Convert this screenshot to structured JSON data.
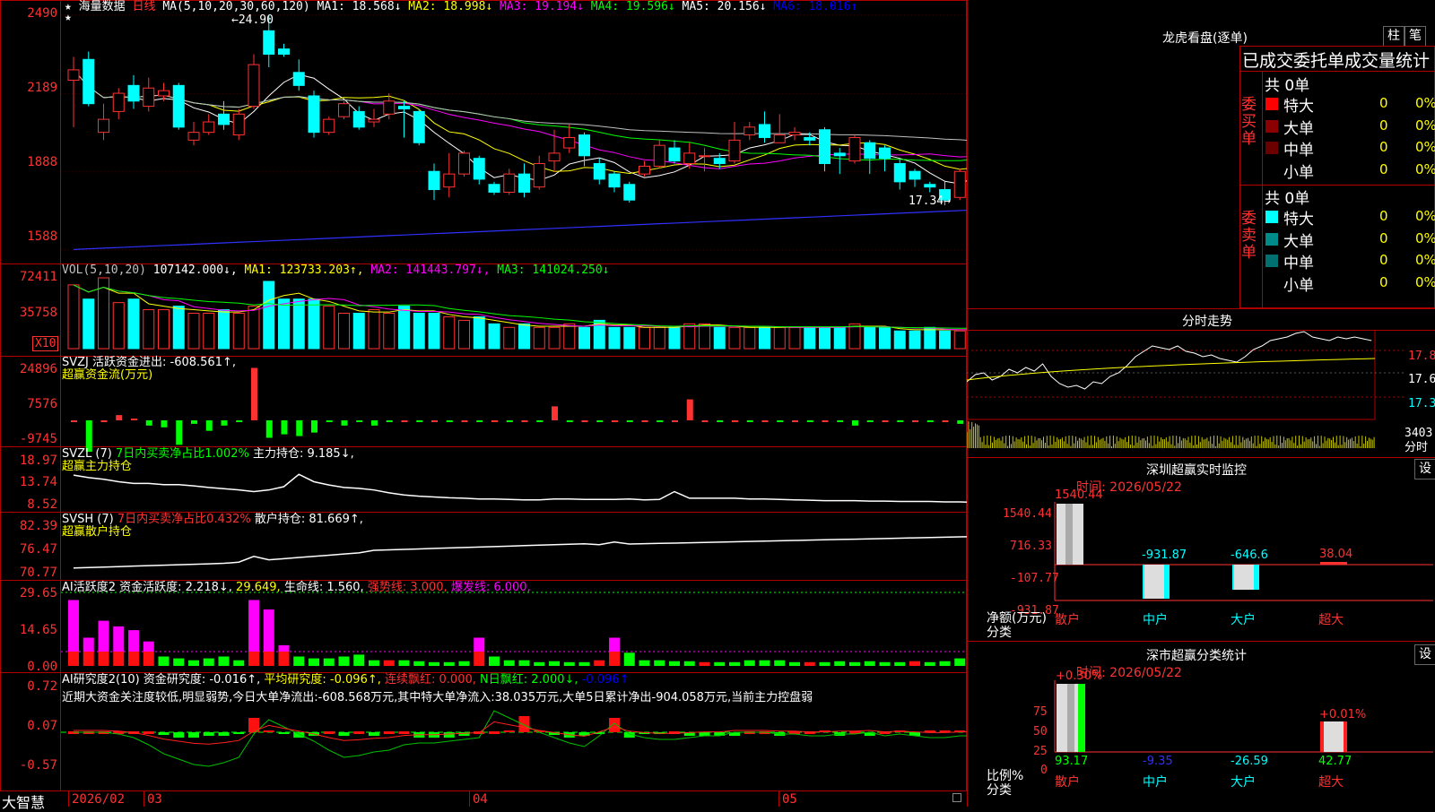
{
  "main": {
    "title": "海量数据",
    "period": "日线",
    "ma_params": "MA(5,10,20,30,60,120)",
    "ma1": "MA1: 18.568↓",
    "ma2": "MA2: 18.998↓",
    "ma3": "MA3: 19.194↓",
    "ma4": "MA4: 19.596↓",
    "ma5": "MA5: 20.156↓",
    "ma6": "MA6: 18.016↑",
    "high_label": "24.90",
    "low_label": "17.34",
    "yticks": [
      "2490",
      "2189",
      "1888",
      "1588"
    ]
  },
  "vol": {
    "header": "VOL(5,10,20)",
    "v": "107142.000↓,",
    "ma1": "MA1: 123733.203↑,",
    "ma2": "MA2: 141443.797↓,",
    "ma3": "MA3: 141024.250↓",
    "yticks": [
      "72411",
      "35758"
    ],
    "unit": "X10"
  },
  "svzj": {
    "line1": "SVZJ  活跃资金进出: -608.561↑,",
    "line2": "超赢资金流(万元)",
    "yticks": [
      "24896",
      "7576",
      "-9745"
    ]
  },
  "svzl": {
    "h1": "SVZL (7)",
    "h2": "7日内买卖净占比1.002%",
    "h3": "主力持仓: 9.185↓,",
    "line2": "超赢主力持仓",
    "yticks": [
      "18.97",
      "13.74",
      "8.52"
    ]
  },
  "svsh": {
    "h1": "SVSH (7)",
    "h2": "7日内买卖净占比0.432%",
    "h3": "散户持仓: 81.669↑,",
    "line2": "超赢散户持仓",
    "yticks": [
      "82.39",
      "76.47",
      "70.77"
    ]
  },
  "ai1": {
    "h1": "AI活跃度2",
    "h2": "资金活跃度: 2.218↓,",
    "h3": "29.649,",
    "h4": "生命线: 1.560,",
    "h5": "强势线: 3.000,",
    "h6": "爆发线: 6.000,",
    "yticks": [
      "29.65",
      "14.65",
      "0.00"
    ]
  },
  "ai2": {
    "h1": "AI研究度2(10)",
    "h2": "资金研究度: -0.016↑,",
    "h3": "平均研究度: -0.096↑,",
    "h4": "连续飘红: 0.000,",
    "h5": "N日飘红: 2.000↓,",
    "h6": "-0.096↑",
    "desc": "近期大资金关注度较低,明显弱势,今日大单净流出:-608.568万元,其中特大单净流入:38.035万元,大单5日累计净出-904.058万元,当前主力控盘弱",
    "yticks": [
      "0.72",
      "0.07",
      "-0.57"
    ]
  },
  "xaxis": {
    "brand": "大智慧",
    "labels": [
      "2026/02",
      "03",
      "04",
      "05"
    ]
  },
  "right": {
    "lhb_title": "龙虎看盘(逐单)",
    "btn_zhu": "柱",
    "btn_bi": "笔",
    "stat_title": "已成交委托单成交量统计",
    "buy_side": "委买单",
    "sell_side": "委卖单",
    "buy_total": "共 0单",
    "sell_total": "共 0单",
    "rows": [
      {
        "label": "特大",
        "v": "0",
        "p": "0%"
      },
      {
        "label": "大单",
        "v": "0",
        "p": "0%"
      },
      {
        "label": "中单",
        "v": "0",
        "p": "0%"
      },
      {
        "label": "小单",
        "v": "0",
        "p": "0%"
      }
    ],
    "fenshi_title": "分时走势",
    "fs_y": [
      "17.85",
      "17.60",
      "17.35"
    ],
    "fs_vol": "3403",
    "fs_vol_unit": "分时",
    "sz_title": "深圳超赢实时监控",
    "sz_btn": "设",
    "sz_time": "时间: 2026/05/22",
    "sz_y": [
      "1540.44",
      "716.33",
      "-107.77",
      "-931.87"
    ],
    "sz_ylabel1": "净额(万元)",
    "sz_ylabel2": "分类",
    "sz_vals": [
      "1540.44",
      "-931.87",
      "-646.6",
      "38.04"
    ],
    "sz_cats": [
      "散户",
      "中户",
      "大户",
      "超大"
    ],
    "ss_title": "深市超赢分类统计",
    "ss_btn": "设",
    "ss_time": "时间: 2026/05/22",
    "ss_y": [
      "75",
      "50",
      "25",
      "0"
    ],
    "ss_ylabel1": "比例%",
    "ss_ylabel2": "分类",
    "ss_tops": [
      "+0.30%",
      "+0.01%"
    ],
    "ss_vals": [
      "93.17",
      "-9.35",
      "-26.59",
      "42.77"
    ],
    "ss_cats": [
      "散户",
      "中户",
      "大户",
      "超大"
    ]
  },
  "chart_data": {
    "type": "candlestick",
    "candles": [
      [
        22.4,
        22.8,
        23.3,
        20.6
      ],
      [
        23.2,
        21.5,
        23.5,
        21.4
      ],
      [
        20.4,
        20.9,
        21.5,
        20.1
      ],
      [
        21.2,
        21.9,
        22.1,
        20.9
      ],
      [
        22.2,
        21.6,
        22.6,
        21.3
      ],
      [
        21.4,
        22.1,
        22.5,
        21.2
      ],
      [
        21.8,
        22.0,
        22.3,
        21.6
      ],
      [
        22.2,
        20.6,
        22.3,
        20.5
      ],
      [
        20.1,
        20.4,
        20.8,
        19.9
      ],
      [
        20.4,
        20.8,
        21.1,
        20.3
      ],
      [
        21.1,
        20.7,
        21.6,
        20.5
      ],
      [
        20.3,
        21.1,
        21.3,
        20.1
      ],
      [
        21.4,
        23.0,
        23.4,
        21.3
      ],
      [
        24.3,
        23.4,
        24.9,
        22.9
      ],
      [
        23.6,
        23.4,
        23.8,
        23.3
      ],
      [
        22.7,
        22.2,
        23.2,
        22.0
      ],
      [
        21.8,
        20.4,
        22.0,
        20.2
      ],
      [
        20.4,
        20.9,
        21.0,
        20.3
      ],
      [
        21.0,
        21.5,
        21.6,
        20.9
      ],
      [
        21.2,
        20.6,
        21.4,
        20.5
      ],
      [
        20.8,
        20.9,
        21.3,
        20.6
      ],
      [
        21.1,
        21.6,
        21.9,
        20.9
      ],
      [
        21.4,
        21.3,
        21.6,
        20.2
      ],
      [
        21.2,
        20.0,
        21.3,
        19.9
      ],
      [
        18.9,
        18.2,
        19.2,
        17.8
      ],
      [
        18.3,
        18.8,
        19.6,
        17.9
      ],
      [
        18.8,
        19.6,
        19.7,
        18.7
      ],
      [
        19.4,
        18.6,
        19.5,
        18.4
      ],
      [
        18.4,
        18.1,
        18.5,
        18.0
      ],
      [
        18.1,
        18.8,
        19.0,
        18.0
      ],
      [
        18.8,
        18.1,
        19.2,
        17.9
      ],
      [
        18.3,
        19.2,
        19.5,
        18.2
      ],
      [
        19.3,
        19.6,
        20.5,
        18.9
      ],
      [
        19.8,
        20.2,
        20.7,
        19.6
      ],
      [
        20.3,
        19.5,
        20.4,
        19.1
      ],
      [
        19.2,
        18.6,
        19.4,
        18.4
      ],
      [
        18.8,
        18.3,
        18.9,
        18.1
      ],
      [
        18.4,
        17.8,
        18.5,
        17.7
      ],
      [
        18.8,
        19.1,
        19.3,
        18.7
      ],
      [
        19.1,
        19.9,
        20.1,
        19.0
      ],
      [
        19.8,
        19.3,
        20.1,
        19.2
      ],
      [
        19.2,
        19.6,
        20.0,
        19.0
      ],
      [
        19.5,
        19.5,
        19.8,
        18.9
      ],
      [
        19.4,
        19.2,
        19.6,
        19.0
      ],
      [
        19.3,
        20.1,
        20.8,
        19.2
      ],
      [
        20.3,
        20.6,
        20.8,
        20.1
      ],
      [
        20.7,
        20.2,
        21.2,
        20.0
      ],
      [
        20.0,
        20.3,
        21.1,
        20.0
      ],
      [
        20.3,
        20.4,
        20.6,
        20.1
      ],
      [
        20.2,
        20.1,
        20.4,
        19.9
      ],
      [
        20.5,
        19.2,
        20.6,
        18.9
      ],
      [
        19.6,
        19.5,
        19.8,
        18.8
      ],
      [
        19.3,
        20.2,
        20.3,
        19.2
      ],
      [
        20.0,
        19.4,
        20.1,
        18.8
      ],
      [
        19.8,
        19.4,
        19.9,
        18.9
      ],
      [
        19.2,
        18.5,
        19.4,
        18.2
      ],
      [
        18.9,
        18.6,
        19.0,
        18.3
      ],
      [
        18.4,
        18.3,
        18.5,
        18.1
      ],
      [
        18.2,
        17.8,
        18.5,
        17.6
      ],
      [
        17.9,
        18.9,
        19.0,
        17.8
      ],
      [
        18.9,
        19.8,
        20.0,
        18.8
      ],
      [
        20.0,
        21.0,
        22.7,
        19.2
      ],
      [
        19.7,
        19.8,
        20.0,
        19.5
      ],
      [
        20.1,
        19.4,
        20.3,
        19.2
      ],
      [
        19.7,
        19.5,
        19.8,
        19.1
      ],
      [
        20.4,
        17.9,
        20.7,
        17.8
      ],
      [
        18.1,
        17.9,
        18.9,
        17.7
      ],
      [
        17.8,
        18.8,
        18.9,
        17.7
      ],
      [
        18.8,
        19.0,
        19.3,
        18.2
      ],
      [
        18.6,
        17.9,
        18.7,
        17.8
      ],
      [
        18.3,
        16.8,
        18.4,
        16.7
      ],
      [
        17.1,
        17.4,
        17.7,
        17.0
      ]
    ],
    "ylim": [
      15.5,
      25.0
    ]
  }
}
